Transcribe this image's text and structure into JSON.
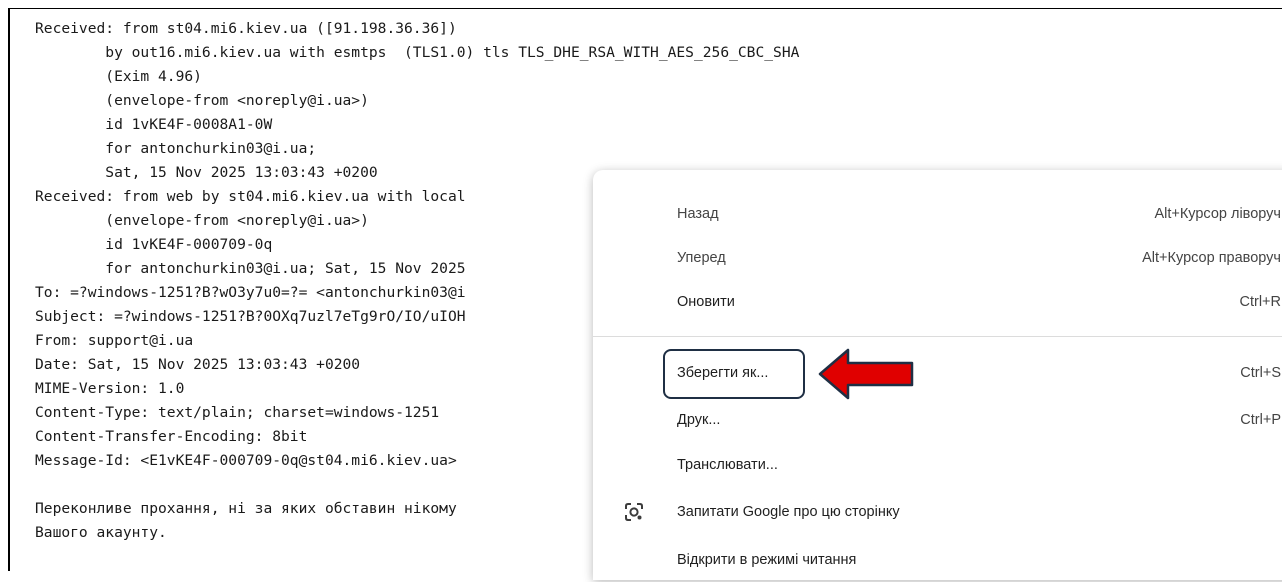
{
  "source_lines": [
    "Received: from st04.mi6.kiev.ua ([91.198.36.36])",
    "        by out16.mi6.kiev.ua with esmtps  (TLS1.0) tls TLS_DHE_RSA_WITH_AES_256_CBC_SHA",
    "        (Exim 4.96)",
    "        (envelope-from <noreply@i.ua>)",
    "        id 1vKE4F-0008A1-0W",
    "        for antonchurkin03@i.ua;",
    "        Sat, 15 Nov 2025 13:03:43 +0200",
    "Received: from web by st04.mi6.kiev.ua with local",
    "        (envelope-from <noreply@i.ua>)",
    "        id 1vKE4F-000709-0q",
    "        for antonchurkin03@i.ua; Sat, 15 Nov 2025",
    "To: =?windows-1251?B?wO3y7u0=?= <antonchurkin03@i",
    "Subject: =?windows-1251?B?0OXq7uzl7eTg9rO/IO/uIOH",
    "From: support@i.ua",
    "Date: Sat, 15 Nov 2025 13:03:43 +0200",
    "MIME-Version: 1.0",
    "Content-Type: text/plain; charset=windows-1251",
    "Content-Transfer-Encoding: 8bit",
    "Message-Id: <E1vKE4F-000709-0q@st04.mi6.kiev.ua>",
    "",
    "Переконливе прохання, ні за яких обставин нікому",
    "Вашого акаунту.",
    "",
    ""
  ],
  "context_menu": {
    "items": [
      {
        "label": "Назад",
        "shortcut": "Alt+Курсор ліворуч"
      },
      {
        "label": "Уперед",
        "shortcut": "Alt+Курсор праворуч"
      },
      {
        "label": "Оновити",
        "shortcut": "Ctrl+R"
      },
      {
        "label": "Зберегти як...",
        "shortcut": "Ctrl+S"
      },
      {
        "label": "Друк...",
        "shortcut": "Ctrl+P"
      },
      {
        "label": "Транслювати...",
        "shortcut": ""
      },
      {
        "label": "Запитати Google про цю сторінку",
        "shortcut": "",
        "icon": "google-lens-icon"
      },
      {
        "label": "Відкрити в режимі читання",
        "shortcut": ""
      }
    ]
  },
  "annotation": {
    "arrow_color": "#e00000",
    "arrow_outline": "#1f2f44",
    "box_color": "#1f2f44"
  }
}
